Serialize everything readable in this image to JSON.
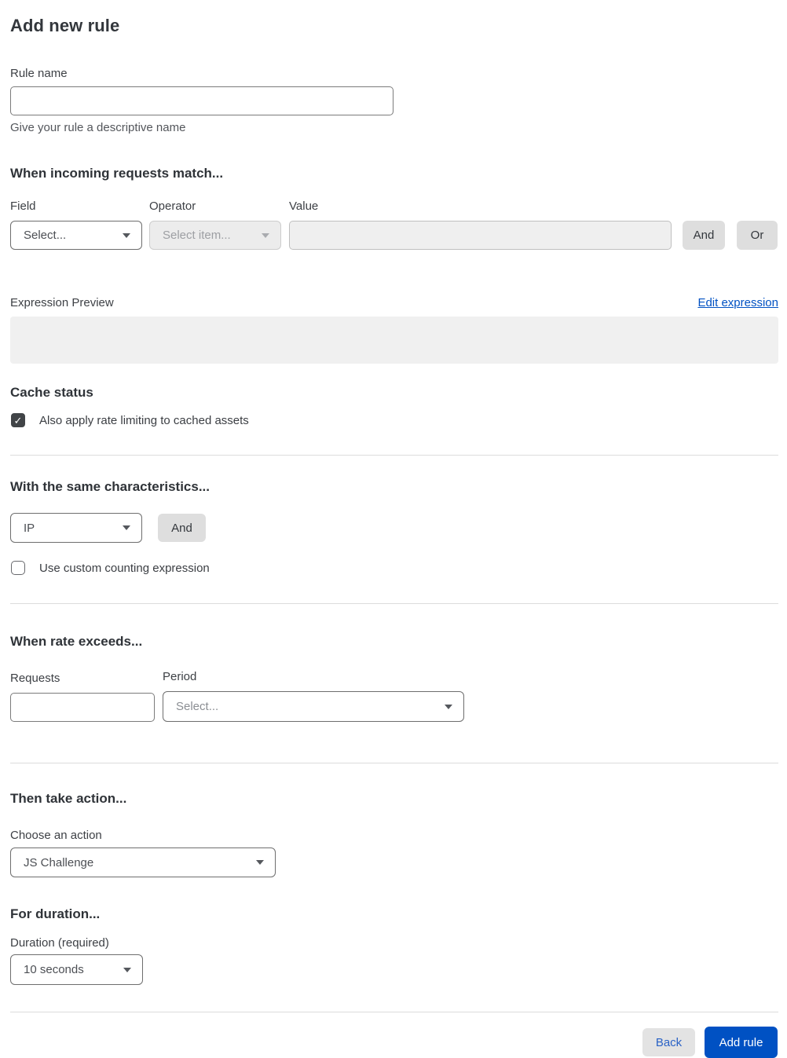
{
  "page": {
    "title": "Add new rule"
  },
  "rule_name": {
    "label": "Rule name",
    "value": "",
    "helper": "Give your rule a descriptive name"
  },
  "match": {
    "heading": "When incoming requests match...",
    "field": {
      "label": "Field",
      "selected": "Select..."
    },
    "operator": {
      "label": "Operator",
      "selected": "Select item...",
      "disabled": true
    },
    "value": {
      "label": "Value",
      "value": "",
      "disabled": true
    },
    "and_label": "And",
    "or_label": "Or",
    "expression_preview_label": "Expression Preview",
    "edit_expression_label": "Edit expression",
    "expression_value": ""
  },
  "cache": {
    "heading": "Cache status",
    "checkbox_label": "Also apply rate limiting to cached assets",
    "checked": true,
    "check_glyph": "✓"
  },
  "characteristics": {
    "heading": "With the same characteristics...",
    "selected": "IP",
    "and_label": "And",
    "checkbox_label": "Use custom counting expression",
    "checked": false
  },
  "rate": {
    "heading": "When rate exceeds...",
    "requests_label": "Requests",
    "requests_value": "",
    "period_label": "Period",
    "period_selected": "Select..."
  },
  "action": {
    "heading": "Then take action...",
    "choose_label": "Choose an action",
    "selected": "JS Challenge"
  },
  "duration": {
    "heading": "For duration...",
    "label": "Duration (required)",
    "selected": "10 seconds"
  },
  "footer": {
    "back_label": "Back",
    "add_rule_label": "Add rule"
  },
  "colors": {
    "primary_blue": "#0051c3",
    "link_blue": "#0051c3",
    "back_text_blue": "#2a62c6",
    "button_gray": "#dedede",
    "disabled_bg": "#ececec",
    "preview_bg": "#f0f0f0",
    "checkbox_checked_bg": "#414447"
  }
}
